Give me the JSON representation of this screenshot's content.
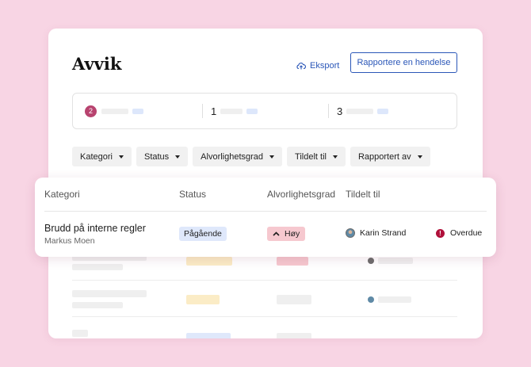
{
  "header": {
    "title": "Avvik",
    "export_label": "Eksport",
    "report_button_label": "Rapportere en hendelse"
  },
  "stats": [
    {
      "value": "2",
      "highlighted": true
    },
    {
      "value": "1",
      "highlighted": false
    },
    {
      "value": "3",
      "highlighted": false
    }
  ],
  "filters": [
    "Kategori",
    "Status",
    "Alvorlighetsgrad",
    "Tildelt til",
    "Rapportert av"
  ],
  "table": {
    "columns": [
      "Kategori",
      "Status",
      "Alvorlighetsgrad",
      "Tildelt til"
    ],
    "row": {
      "category": "Brudd på interne regler",
      "reporter": "Markus Moen",
      "status": "Pågående",
      "severity": "Høy",
      "assignee": "Karin Strand",
      "due_status": "Overdue"
    }
  },
  "colors": {
    "background": "#f8d5e4",
    "accent": "#2b57b8",
    "badge": "#b8436f",
    "status_chip": "#dfe8fb",
    "severity_chip": "#f6c8cf",
    "overdue": "#b0103a"
  },
  "icons": {
    "export": "cloud-upload-icon",
    "severity": "chevron-up-icon",
    "overdue": "exclamation-circle-icon",
    "filter": "caret-down-icon"
  }
}
